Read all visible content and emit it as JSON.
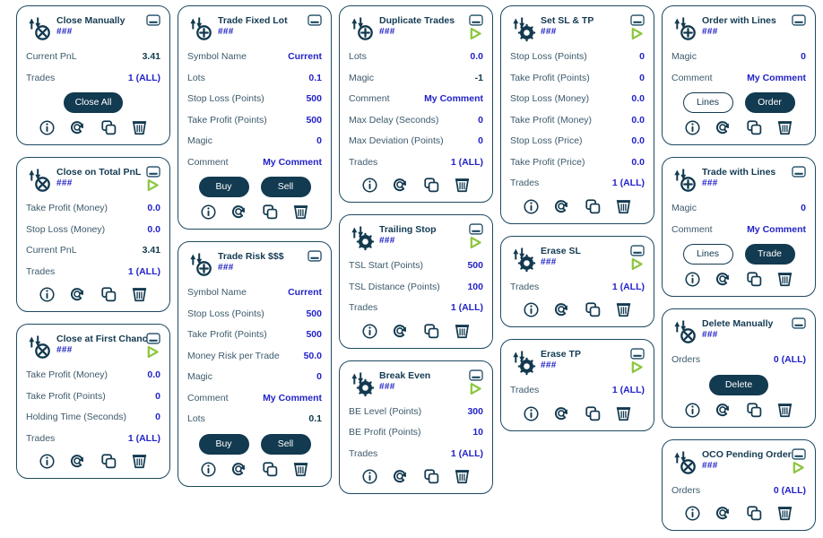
{
  "theme": {
    "border": "#1d4a63",
    "title": "#133a52",
    "label": "#3c5a6b",
    "value_blue": "#2222c8",
    "value_dark": "#12394f",
    "button_fill": "#123a50",
    "play_green": "#8cc63f"
  },
  "icons": {
    "minimize": "minimize-icon",
    "play": "play-icon",
    "info": "info-icon",
    "refresh": "refresh-icon",
    "copy": "copy-icon",
    "trash": "trash-icon",
    "close_trade": "close-trade-icon",
    "add_trade": "add-trade-icon",
    "modify_trade": "modify-trade-icon"
  },
  "footer_labels": {
    "info": "Info",
    "refresh": "Refresh",
    "copy": "Copy",
    "trash": "Delete"
  },
  "columns": [
    {
      "id": "col0",
      "panels": [
        {
          "id": "close-manually",
          "title": "Close Manually",
          "subtitle": "###",
          "icon": "close-trade-icon",
          "has_play": false,
          "rows": [
            {
              "label": "Current PnL",
              "value": "3.41",
              "style": "dark"
            },
            {
              "label": "Trades",
              "value": "1 (ALL)",
              "style": "blue"
            }
          ],
          "buttons": [
            {
              "label": "Close All",
              "variant": "filled",
              "wide": true
            }
          ]
        },
        {
          "id": "close-on-total-pnl",
          "title": "Close on Total PnL",
          "subtitle": "###",
          "icon": "close-trade-icon",
          "has_play": true,
          "rows": [
            {
              "label": "Take Profit (Money)",
              "value": "0.0",
              "style": "blue"
            },
            {
              "label": "Stop Loss (Money)",
              "value": "0.0",
              "style": "blue"
            },
            {
              "label": "Current PnL",
              "value": "3.41",
              "style": "dark"
            },
            {
              "label": "Trades",
              "value": "1 (ALL)",
              "style": "blue"
            }
          ],
          "buttons": []
        },
        {
          "id": "close-at-first-chance",
          "title": "Close at First Chance",
          "subtitle": "###",
          "icon": "close-trade-icon",
          "has_play": true,
          "rows": [
            {
              "label": "Take Profit (Money)",
              "value": "0.0",
              "style": "blue"
            },
            {
              "label": "Take Profit (Points)",
              "value": "0",
              "style": "blue"
            },
            {
              "label": "Holding Time (Seconds)",
              "value": "0",
              "style": "blue"
            },
            {
              "label": "Trades",
              "value": "1 (ALL)",
              "style": "blue"
            }
          ],
          "buttons": []
        }
      ]
    },
    {
      "id": "col1",
      "panels": [
        {
          "id": "trade-fixed-lot",
          "title": "Trade Fixed Lot",
          "subtitle": "###",
          "icon": "add-trade-icon",
          "has_play": false,
          "rows": [
            {
              "label": "Symbol Name",
              "value": "Current",
              "style": "blue"
            },
            {
              "label": "Lots",
              "value": "0.1",
              "style": "blue"
            },
            {
              "label": "Stop Loss (Points)",
              "value": "500",
              "style": "blue"
            },
            {
              "label": "Take Profit (Points)",
              "value": "500",
              "style": "blue"
            },
            {
              "label": "Magic",
              "value": "0",
              "style": "blue"
            },
            {
              "label": "Comment",
              "value": "My Comment",
              "style": "blue"
            }
          ],
          "buttons": [
            {
              "label": "Buy",
              "variant": "filled",
              "wide": false
            },
            {
              "label": "Sell",
              "variant": "filled",
              "wide": false
            }
          ]
        },
        {
          "id": "trade-risk",
          "title": "Trade Risk $$$",
          "subtitle": "###",
          "icon": "add-trade-icon",
          "has_play": false,
          "rows": [
            {
              "label": "Symbol Name",
              "value": "Current",
              "style": "blue"
            },
            {
              "label": "Stop Loss (Points)",
              "value": "500",
              "style": "blue"
            },
            {
              "label": "Take Profit (Points)",
              "value": "500",
              "style": "blue"
            },
            {
              "label": "Money Risk per Trade",
              "value": "50.0",
              "style": "blue"
            },
            {
              "label": "Magic",
              "value": "0",
              "style": "blue"
            },
            {
              "label": "Comment",
              "value": "My Comment",
              "style": "blue"
            },
            {
              "label": "Lots",
              "value": "0.1",
              "style": "dark"
            }
          ],
          "buttons": [
            {
              "label": "Buy",
              "variant": "filled",
              "wide": false
            },
            {
              "label": "Sell",
              "variant": "filled",
              "wide": false
            }
          ]
        }
      ]
    },
    {
      "id": "col2",
      "panels": [
        {
          "id": "duplicate-trades",
          "title": "Duplicate Trades",
          "subtitle": "###",
          "icon": "add-trade-icon",
          "has_play": true,
          "rows": [
            {
              "label": "Lots",
              "value": "0.0",
              "style": "blue"
            },
            {
              "label": "Magic",
              "value": "-1",
              "style": "dark"
            },
            {
              "label": "Comment",
              "value": "My Comment",
              "style": "blue"
            },
            {
              "label": "Max Delay (Seconds)",
              "value": "0",
              "style": "blue"
            },
            {
              "label": "Max Deviation (Points)",
              "value": "0",
              "style": "blue"
            },
            {
              "label": "Trades",
              "value": "1 (ALL)",
              "style": "blue"
            }
          ],
          "buttons": []
        },
        {
          "id": "trailing-stop",
          "title": "Trailing Stop",
          "subtitle": "###",
          "icon": "modify-trade-icon",
          "has_play": true,
          "rows": [
            {
              "label": "TSL Start (Points)",
              "value": "500",
              "style": "blue"
            },
            {
              "label": "TSL Distance (Points)",
              "value": "100",
              "style": "blue"
            },
            {
              "label": "Trades",
              "value": "1 (ALL)",
              "style": "blue"
            }
          ],
          "buttons": []
        },
        {
          "id": "break-even",
          "title": "Break Even",
          "subtitle": "###",
          "icon": "modify-trade-icon",
          "has_play": true,
          "rows": [
            {
              "label": "BE Level (Points)",
              "value": "300",
              "style": "blue"
            },
            {
              "label": "BE Profit (Points)",
              "value": "10",
              "style": "blue"
            },
            {
              "label": "Trades",
              "value": "1 (ALL)",
              "style": "blue"
            }
          ],
          "buttons": []
        }
      ]
    },
    {
      "id": "col3",
      "panels": [
        {
          "id": "set-sl-tp",
          "title": "Set SL & TP",
          "subtitle": "###",
          "icon": "modify-trade-icon",
          "has_play": true,
          "rows": [
            {
              "label": "Stop Loss (Points)",
              "value": "0",
              "style": "blue"
            },
            {
              "label": "Take Profit (Points)",
              "value": "0",
              "style": "blue"
            },
            {
              "label": "Stop Loss (Money)",
              "value": "0.0",
              "style": "blue"
            },
            {
              "label": "Take Profit (Money)",
              "value": "0.0",
              "style": "blue"
            },
            {
              "label": "Stop Loss (Price)",
              "value": "0.0",
              "style": "blue"
            },
            {
              "label": "Take Profit (Price)",
              "value": "0.0",
              "style": "blue"
            },
            {
              "label": "Trades",
              "value": "1 (ALL)",
              "style": "blue"
            }
          ],
          "buttons": []
        },
        {
          "id": "erase-sl",
          "title": "Erase SL",
          "subtitle": "###",
          "icon": "modify-trade-icon",
          "has_play": true,
          "rows": [
            {
              "label": "Trades",
              "value": "1 (ALL)",
              "style": "blue"
            }
          ],
          "buttons": []
        },
        {
          "id": "erase-tp",
          "title": "Erase TP",
          "subtitle": "###",
          "icon": "modify-trade-icon",
          "has_play": true,
          "rows": [
            {
              "label": "Trades",
              "value": "1 (ALL)",
              "style": "blue"
            }
          ],
          "buttons": []
        }
      ]
    },
    {
      "id": "col4",
      "panels": [
        {
          "id": "order-with-lines",
          "title": "Order with Lines",
          "subtitle": "###",
          "icon": "add-trade-icon",
          "has_play": false,
          "rows": [
            {
              "label": "Magic",
              "value": "0",
              "style": "blue"
            },
            {
              "label": "Comment",
              "value": "My Comment",
              "style": "blue"
            }
          ],
          "buttons": [
            {
              "label": "Lines",
              "variant": "outline",
              "wide": false
            },
            {
              "label": "Order",
              "variant": "filled",
              "wide": false
            }
          ]
        },
        {
          "id": "trade-with-lines",
          "title": "Trade with Lines",
          "subtitle": "###",
          "icon": "add-trade-icon",
          "has_play": false,
          "rows": [
            {
              "label": "Magic",
              "value": "0",
              "style": "blue"
            },
            {
              "label": "Comment",
              "value": "My Comment",
              "style": "blue"
            }
          ],
          "buttons": [
            {
              "label": "Lines",
              "variant": "outline",
              "wide": false
            },
            {
              "label": "Trade",
              "variant": "filled",
              "wide": false
            }
          ]
        },
        {
          "id": "delete-manually",
          "title": "Delete Manually",
          "subtitle": "###",
          "icon": "close-trade-icon",
          "has_play": false,
          "rows": [
            {
              "label": "Orders",
              "value": "0 (ALL)",
              "style": "blue"
            }
          ],
          "buttons": [
            {
              "label": "Delete",
              "variant": "filled",
              "wide": true
            }
          ]
        },
        {
          "id": "oco-pending-orders",
          "title": "OCO Pending Orders",
          "subtitle": "###",
          "icon": "close-trade-icon",
          "has_play": true,
          "rows": [
            {
              "label": "Orders",
              "value": "0 (ALL)",
              "style": "blue"
            }
          ],
          "buttons": []
        }
      ]
    }
  ]
}
